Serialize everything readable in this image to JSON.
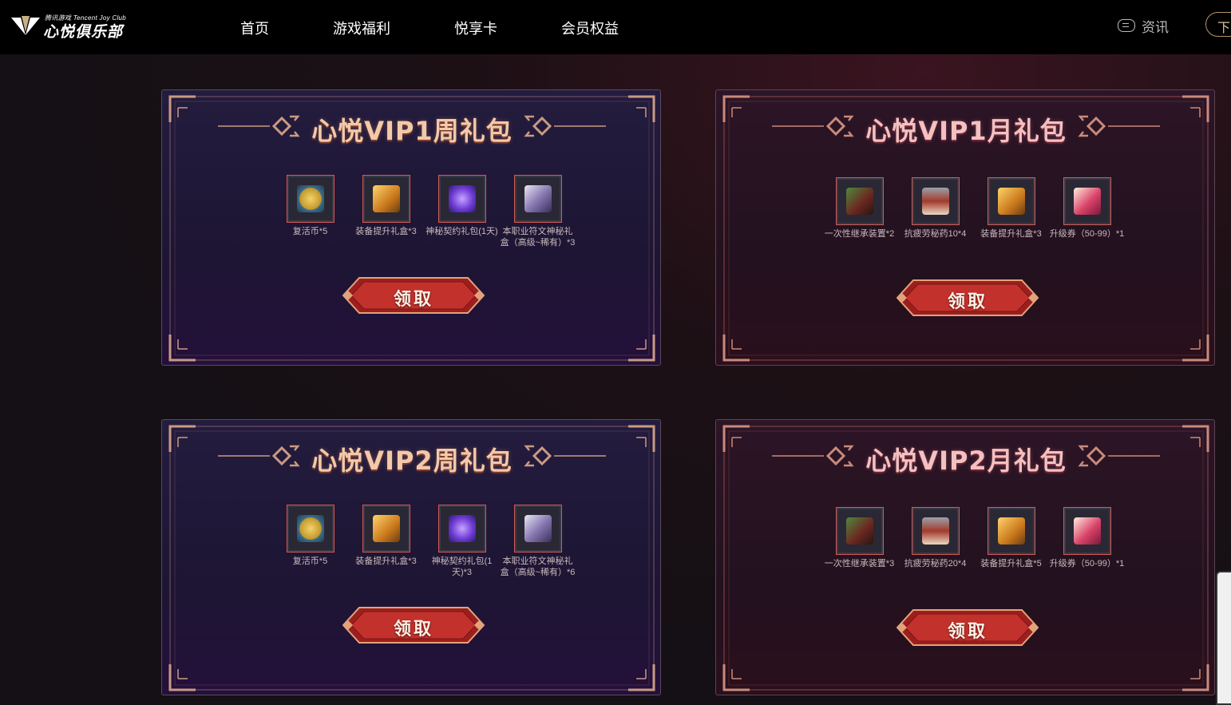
{
  "header": {
    "logo_small": "腾讯游戏 Tencent Joy Club",
    "logo_name": "心悦俱乐部",
    "nav": [
      {
        "label": "首页"
      },
      {
        "label": "游戏福利"
      },
      {
        "label": "悦享卡"
      },
      {
        "label": "会员权益"
      }
    ],
    "news_label": "资讯",
    "download_label": "下"
  },
  "colors": {
    "accent_red": "#c8302c",
    "slot_border": "#d05b55",
    "title_week": "#f3c9a8",
    "title_month": "#f4c0c0"
  },
  "packages": [
    {
      "title": "心悦VIP1周礼包",
      "theme": "week",
      "claim_label": "领取",
      "items": [
        {
          "icon": "coin-icon",
          "label": "复活币*5"
        },
        {
          "icon": "gold-chest-icon",
          "label": "装备提升礼盒*3"
        },
        {
          "icon": "purple-bag-icon",
          "label": "神秘契约礼包(1天)"
        },
        {
          "icon": "rune-box-icon",
          "label": "本职业符文神秘礼盒（高级~稀有）*3"
        }
      ]
    },
    {
      "title": "心悦VIP1月礼包",
      "theme": "month",
      "claim_label": "领取",
      "items": [
        {
          "icon": "inherit-device-icon",
          "label": "一次性继承装置*2"
        },
        {
          "icon": "potion-icon",
          "label": "抗疲劳秘药10*4"
        },
        {
          "icon": "gold-chest-icon",
          "label": "装备提升礼盒*3"
        },
        {
          "icon": "level-ticket-icon",
          "label": "升级券（50-99）*1"
        }
      ]
    },
    {
      "title": "心悦VIP2周礼包",
      "theme": "week",
      "claim_label": "领取",
      "items": [
        {
          "icon": "coin-icon",
          "label": "复活币*5"
        },
        {
          "icon": "gold-chest-icon",
          "label": "装备提升礼盒*3"
        },
        {
          "icon": "purple-bag-icon",
          "label": "神秘契约礼包(1天)*3"
        },
        {
          "icon": "rune-box-icon",
          "label": "本职业符文神秘礼盒（高级~稀有）*6"
        }
      ]
    },
    {
      "title": "心悦VIP2月礼包",
      "theme": "month",
      "claim_label": "领取",
      "items": [
        {
          "icon": "inherit-device-icon",
          "label": "一次性继承装置*3"
        },
        {
          "icon": "potion-icon",
          "label": "抗疲劳秘药20*4"
        },
        {
          "icon": "gold-chest-icon",
          "label": "装备提升礼盒*5"
        },
        {
          "icon": "level-ticket-icon",
          "label": "升级券（50-99）*1"
        }
      ]
    }
  ]
}
